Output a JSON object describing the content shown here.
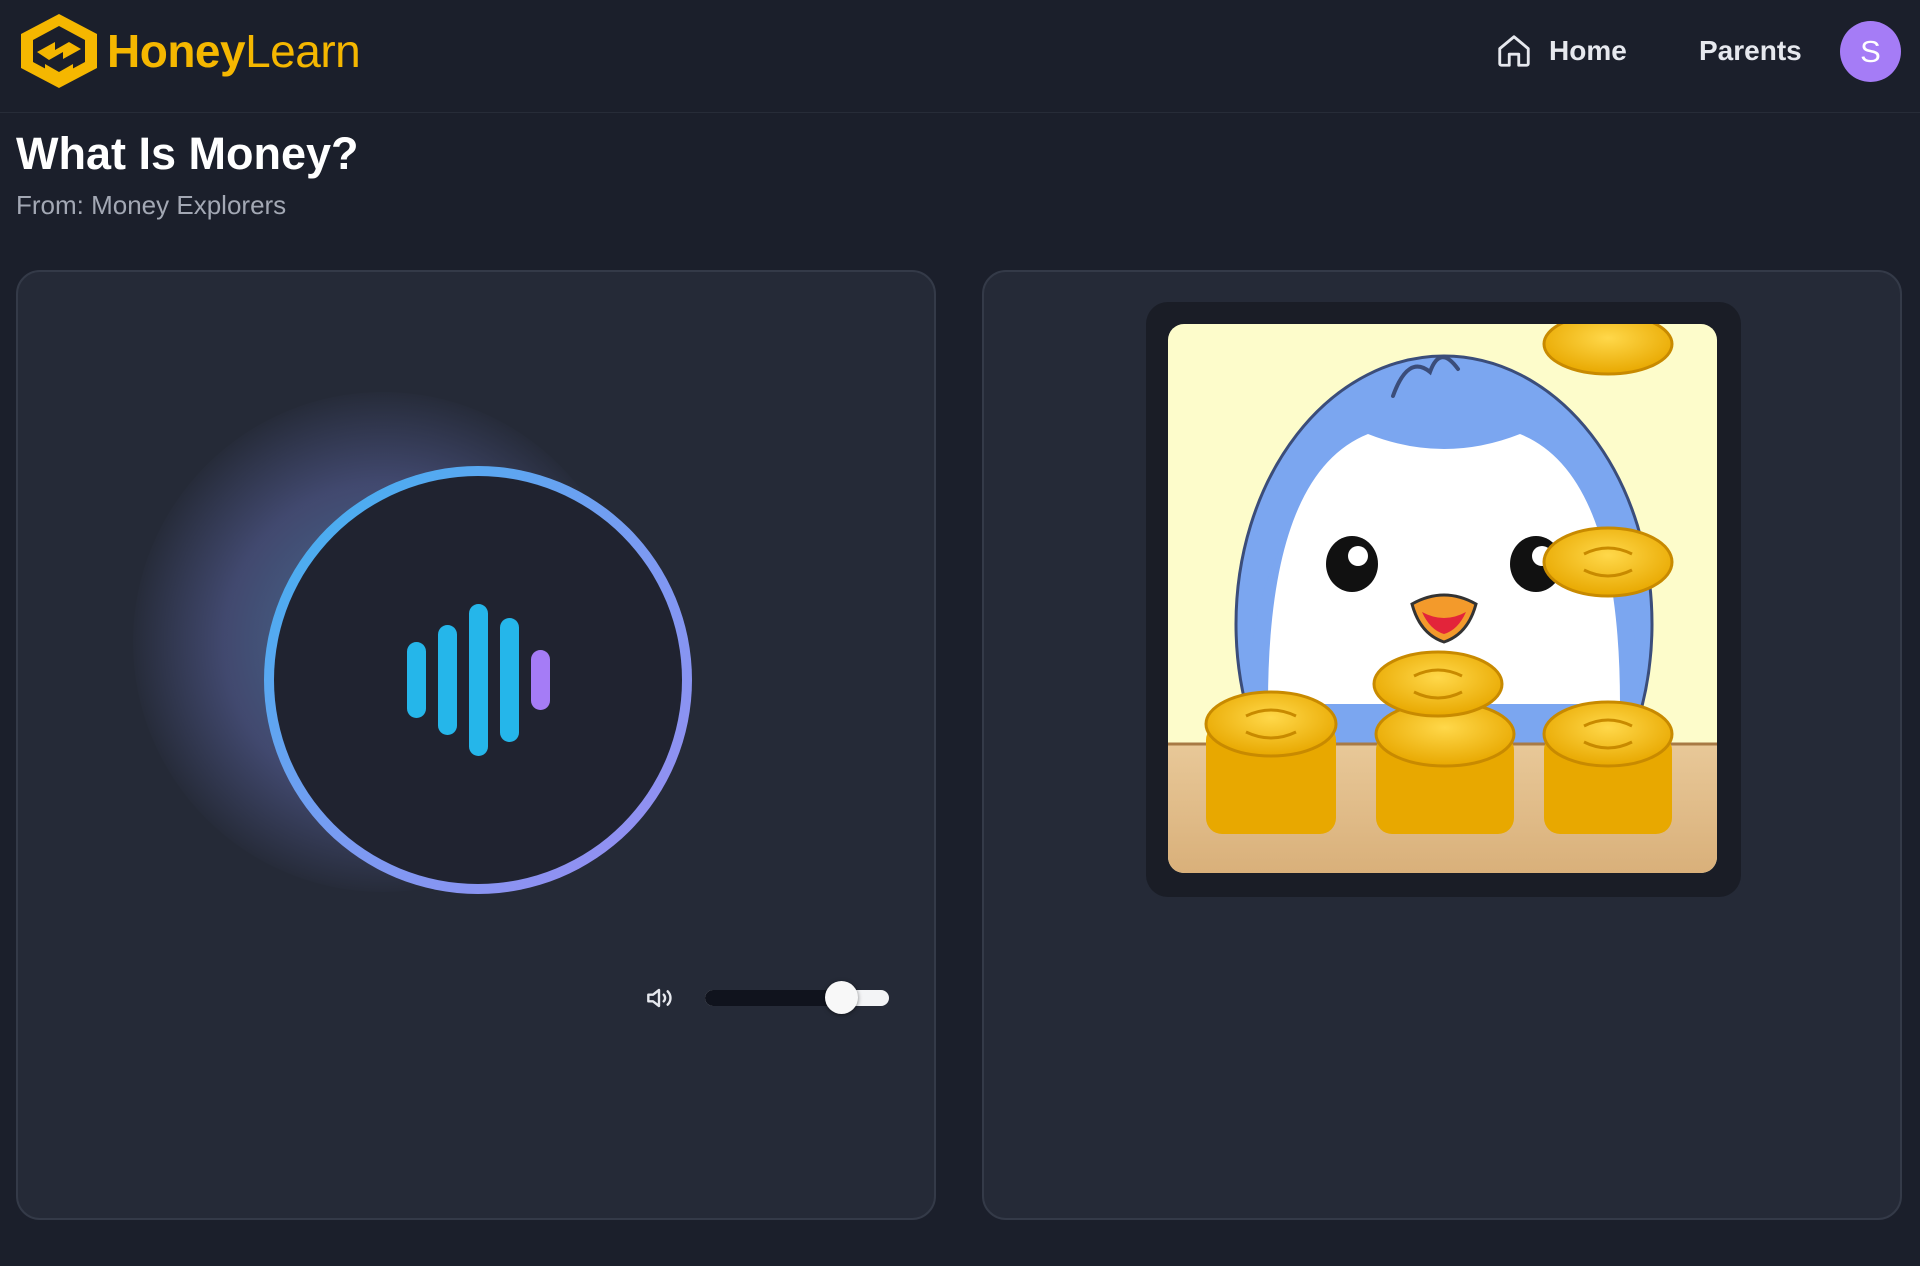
{
  "header": {
    "logo_text_bold": "Honey",
    "logo_text_light": "Learn",
    "nav": {
      "home_label": "Home",
      "home_icon": "house-icon",
      "parents_label": "Parents"
    },
    "avatar_initial": "S",
    "avatar_color": "#a57cf6"
  },
  "lesson": {
    "title": "What Is Money?",
    "subtitle": "From: Money Explorers"
  },
  "player": {
    "play_icon": "audio-waveform-icon",
    "volume_icon": "speaker-icon",
    "volume_fraction": 0.74
  },
  "illustration": {
    "description_icon": "penguin-with-coins-illustration"
  },
  "colors": {
    "background": "#1b1f2b",
    "card": "#252a37",
    "brand": "#f5b700",
    "accent_blue": "#25b6ea",
    "accent_purple": "#a57cf6"
  }
}
